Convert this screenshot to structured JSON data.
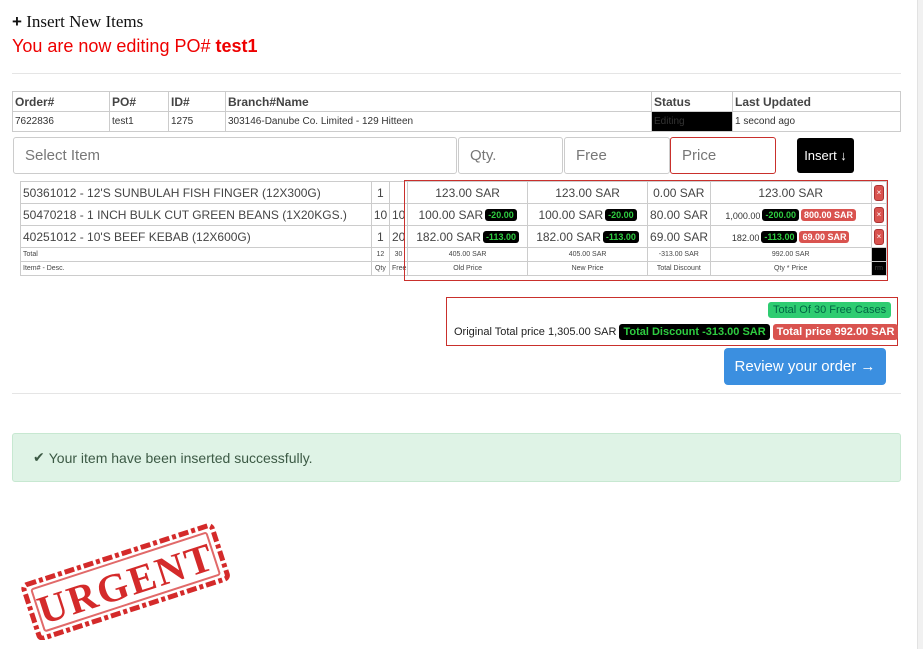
{
  "header": {
    "plus": "+",
    "title": "Insert New Items",
    "editing_prefix": "You are now editing PO#",
    "po": "test1"
  },
  "order_info": {
    "headers": [
      "Order#",
      "PO#",
      "ID#",
      "Branch#Name",
      "Status",
      "Last Updated"
    ],
    "order": "7622836",
    "po": "test1",
    "id": "1275",
    "branch": "303146-Danube Co. Limited - 129 Hitteen",
    "status": "Editing",
    "last_updated": "1 second ago"
  },
  "form": {
    "item_placeholder": "Select Item",
    "qty_placeholder": "Qty.",
    "free_placeholder": "Free",
    "price_placeholder": "Price",
    "insert_label": "Insert ↓"
  },
  "items": [
    {
      "desc": "50361012 - 12'S SUNBULAH FISH FINGER (12X300G)",
      "qty": "1",
      "free": "",
      "old_price": "123.00 SAR",
      "old_disc": "",
      "new_price": "123.00 SAR",
      "new_disc": "",
      "total_discount": "0.00 SAR",
      "line_total": "123.00 SAR",
      "line_disc": "",
      "line_net": "",
      "remove": "×"
    },
    {
      "desc": "50470218 - 1 INCH BULK CUT GREEN BEANS (1X20KGS.)",
      "qty": "10",
      "free": "10",
      "old_price": "100.00 SAR",
      "old_disc": "-20.00",
      "new_price": "100.00 SAR",
      "new_disc": "-20.00",
      "total_discount": "80.00 SAR",
      "line_total": "1,000.00",
      "line_disc": "-200.00",
      "line_net": "800.00 SAR",
      "remove": "×"
    },
    {
      "desc": "40251012 - 10'S BEEF KEBAB (12X600G)",
      "qty": "1",
      "free": "20",
      "old_price": "182.00 SAR",
      "old_disc": "-113.00",
      "new_price": "182.00 SAR",
      "new_disc": "-113.00",
      "total_discount": "69.00 SAR",
      "line_total": "182.00",
      "line_disc": "-113.00",
      "line_net": "69.00 SAR",
      "remove": "×"
    }
  ],
  "totals_row": {
    "label": "Total",
    "qty": "12",
    "free": "30",
    "old": "405.00 SAR",
    "new": "405.00 SAR",
    "disc": "-313.00 SAR",
    "line": "992.00 SAR"
  },
  "labels_row": {
    "desc": "Item# - Desc.",
    "qty": "Qty",
    "free": "Free",
    "old": "Old Price",
    "new": "New Price",
    "disc": "Total Discount",
    "line": "Qty * Price",
    "end": "rm"
  },
  "summary": {
    "free_cases": "Total Of 30 Free Cases",
    "original_total": "Original Total price 1,305.00 SAR",
    "total_discount": "Total Discount -313.00 SAR",
    "total_price": "Total price 992.00 SAR"
  },
  "review_label": "Review your order →",
  "alert": {
    "check": "✔",
    "message": "Your item have been inserted successfully."
  },
  "stamp": {
    "text": "URGENT",
    "color": "#d42a2a"
  }
}
